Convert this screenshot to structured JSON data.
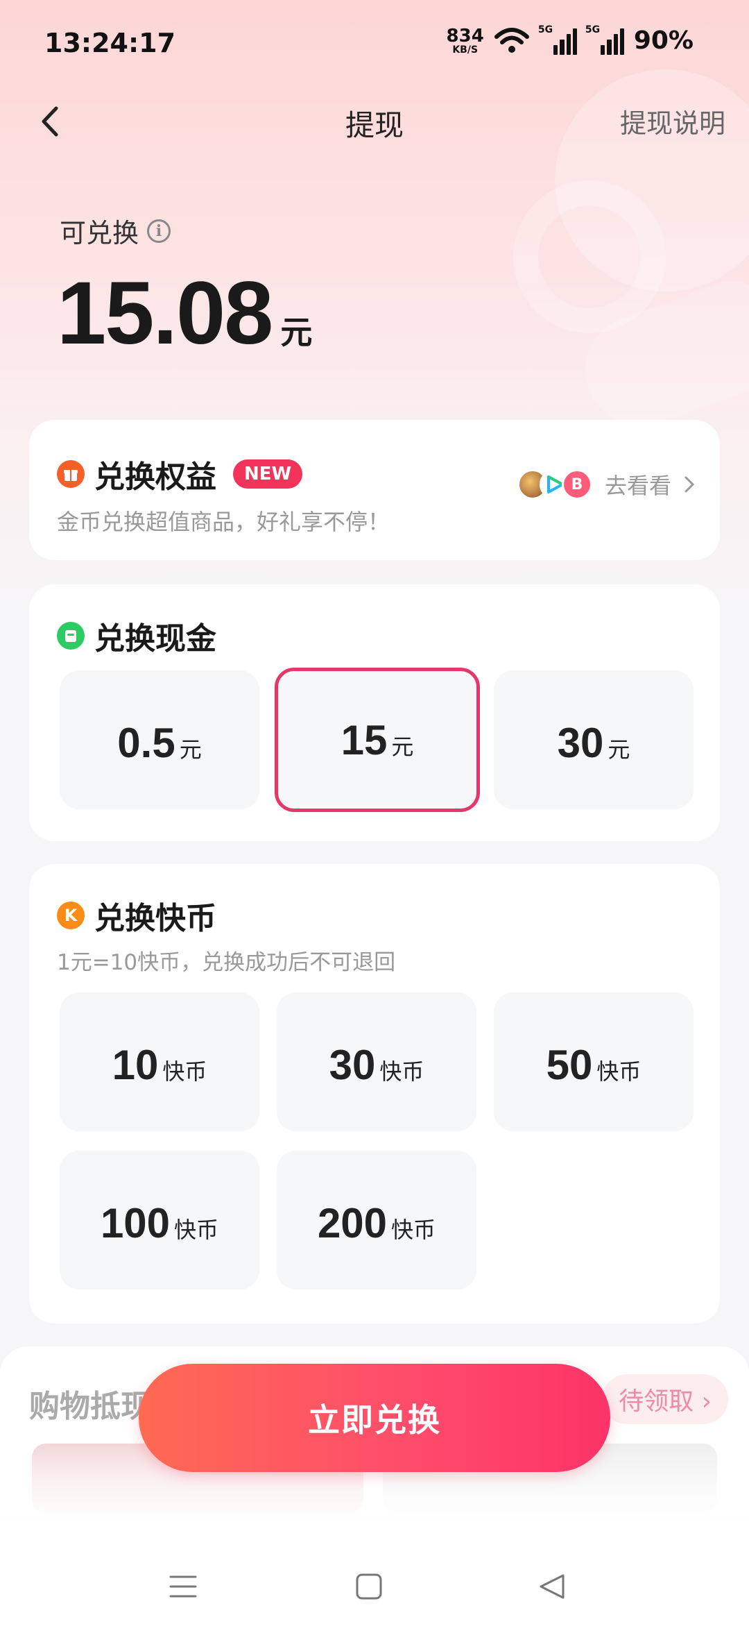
{
  "status_bar": {
    "time": "13:24:17",
    "net_speed_value": "834",
    "net_speed_unit": "KB/S",
    "signal1_label": "5G",
    "signal2_label": "5G",
    "battery": "90%"
  },
  "nav": {
    "title": "提现",
    "right_link": "提现说明"
  },
  "balance": {
    "label": "可兑换",
    "amount": "15.08",
    "unit": "元"
  },
  "benefits": {
    "title": "兑换权益",
    "badge": "NEW",
    "subtitle": "金币兑换超值商品，好礼享不停！",
    "link": "去看看"
  },
  "cash": {
    "title": "兑换现金",
    "options": [
      {
        "value": "0.5",
        "unit": "元",
        "selected": false
      },
      {
        "value": "15",
        "unit": "元",
        "selected": true
      },
      {
        "value": "30",
        "unit": "元",
        "selected": false
      }
    ]
  },
  "coins": {
    "icon_letter": "K",
    "title": "兑换快币",
    "subtitle": "1元=10快币，兑换成功后不可退回",
    "options": [
      {
        "value": "10",
        "unit": "快币"
      },
      {
        "value": "30",
        "unit": "快币"
      },
      {
        "value": "50",
        "unit": "快币"
      },
      {
        "value": "100",
        "unit": "快币"
      },
      {
        "value": "200",
        "unit": "快币"
      }
    ]
  },
  "shopping": {
    "title_visible": "购物抵现",
    "right_visible": "待领取"
  },
  "cta": {
    "label": "立即兑换"
  },
  "colors": {
    "accent": "#fd3367",
    "selected_border": "#e6376a",
    "benefit_icon": "#f5602a",
    "cash_icon": "#2ccb63",
    "coin_icon": "#fa8c16"
  }
}
